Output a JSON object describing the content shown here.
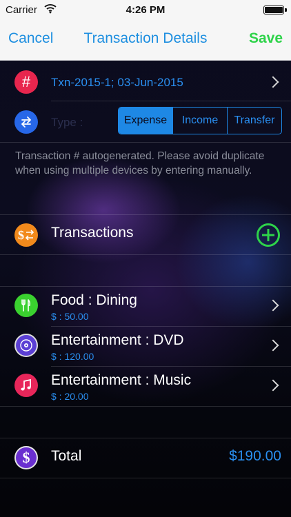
{
  "status_bar": {
    "carrier": "Carrier",
    "time": "4:26 PM"
  },
  "nav": {
    "cancel_label": "Cancel",
    "title": "Transaction Details",
    "save_label": "Save"
  },
  "transaction": {
    "number_icon_glyph": "#",
    "id_text": "Txn-2015-1; 03-Jun-2015",
    "type_label": "Type :",
    "type_options": [
      "Expense",
      "Income",
      "Transfer"
    ],
    "selected_type": "Expense",
    "note": "Transaction # autogenerated. Please avoid duplicate when using multiple devices by entering manually."
  },
  "section": {
    "title": "Transactions"
  },
  "items": [
    {
      "title": "Food : Dining",
      "amount": "$ : 50.00",
      "icon": "fork-knife-icon",
      "color": "#3ad12f"
    },
    {
      "title": "Entertainment : DVD",
      "amount": "$ : 120.00",
      "icon": "disc-icon",
      "color": "#5b3fd4"
    },
    {
      "title": "Entertainment : Music",
      "amount": "$ : 20.00",
      "icon": "music-note-icon",
      "color": "#e8265a"
    }
  ],
  "total": {
    "label": "Total",
    "value": "$190.00"
  },
  "colors": {
    "accent_blue": "#1e88e5",
    "save_green": "#2ed34a",
    "hash_red": "#e8264e",
    "type_blue": "#2767e8",
    "transactions_orange": "#f28a1c",
    "total_purple": "#6a2fd0"
  }
}
